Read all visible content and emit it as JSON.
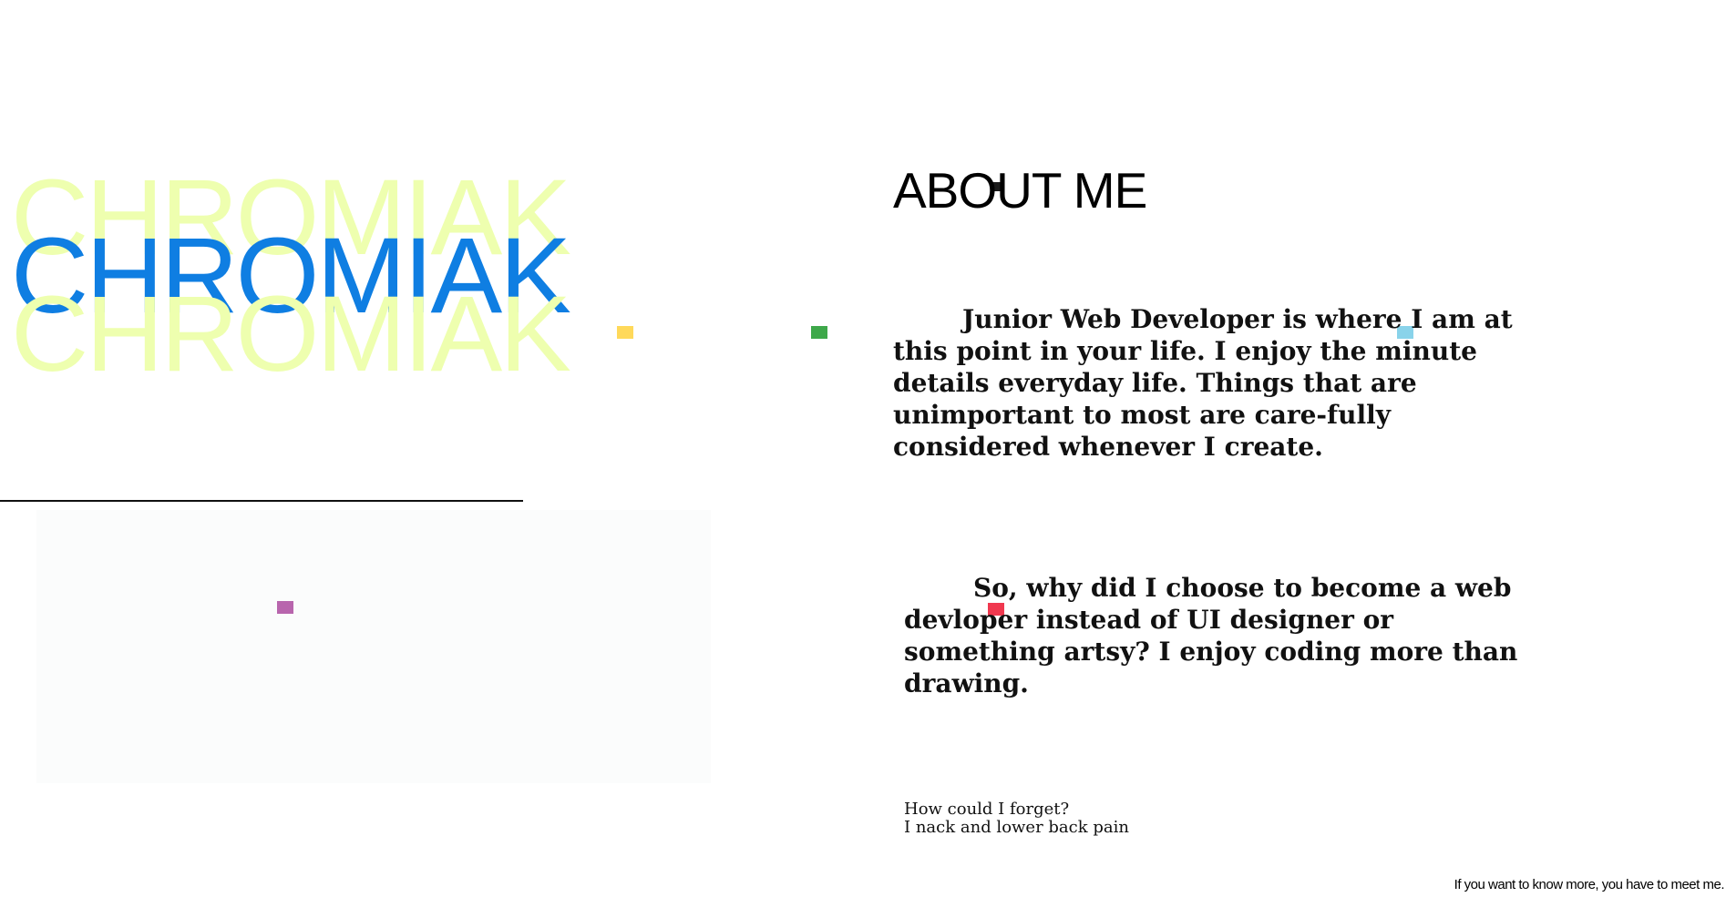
{
  "brand": {
    "name": "CHROMIAK",
    "shadow_name_top": "CHROMIAK",
    "shadow_name_bottom": "CHROMIAK"
  },
  "about": {
    "title": "ABOUT ME",
    "paragraphs": [
      "Junior Web Developer is where I am at this point in your life. I enjoy the minute details everyday life. Things that are unimportant to most are care-fully considered whenever I create.",
      "So, why did I choose to become a web devloper instead of UI designer or something artsy?  I enjoy coding more than drawing."
    ],
    "aside_lines": [
      "How could I forget?",
      "I nack and lower back pain"
    ]
  },
  "footer": {
    "note": "If you want to know more, you have to meet me."
  },
  "colors": {
    "accent_blue": "#0f7ee2",
    "shadow_yellow_green": "#eeffaf",
    "rule_black": "#111111",
    "dot_yellow": "#ffd95a",
    "dot_green": "#3ea84a",
    "dot_cyan": "#89d3ea",
    "dot_red": "#f0384f",
    "dot_magenta": "#b865ad",
    "dot_dark": "#1a1a1a"
  }
}
